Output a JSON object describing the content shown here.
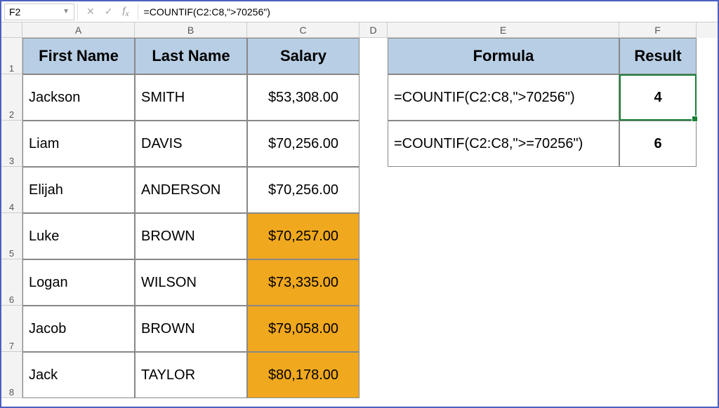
{
  "nameBox": "F2",
  "formulaInput": "=COUNTIF(C2:C8,\">70256\")",
  "columns": [
    "A",
    "B",
    "C",
    "D",
    "E",
    "F"
  ],
  "rows": [
    "1",
    "2",
    "3",
    "4",
    "5",
    "6",
    "7",
    "8"
  ],
  "headers": {
    "A": "First Name",
    "B": "Last Name",
    "C": "Salary",
    "E": "Formula",
    "F": "Result"
  },
  "people": [
    {
      "first": "Jackson",
      "last": "SMITH",
      "salary": "$53,308.00",
      "hl": false
    },
    {
      "first": "Liam",
      "last": "DAVIS",
      "salary": "$70,256.00",
      "hl": false
    },
    {
      "first": "Elijah",
      "last": "ANDERSON",
      "salary": "$70,256.00",
      "hl": false
    },
    {
      "first": "Luke",
      "last": "BROWN",
      "salary": "$70,257.00",
      "hl": true
    },
    {
      "first": "Logan",
      "last": "WILSON",
      "salary": "$73,335.00",
      "hl": true
    },
    {
      "first": "Jacob",
      "last": "BROWN",
      "salary": "$79,058.00",
      "hl": true
    },
    {
      "first": "Jack",
      "last": "TAYLOR",
      "salary": "$80,178.00",
      "hl": true
    }
  ],
  "formulas": [
    {
      "text": "=COUNTIF(C2:C8,\">70256\")",
      "result": "4"
    },
    {
      "text": "=COUNTIF(C2:C8,\">=70256\")",
      "result": "6"
    }
  ],
  "colWidths": {
    "A": 160,
    "B": 160,
    "C": 160,
    "D": 40,
    "E": 330,
    "F": 110
  },
  "rowHeights": {
    "header": 52,
    "data": 66
  }
}
